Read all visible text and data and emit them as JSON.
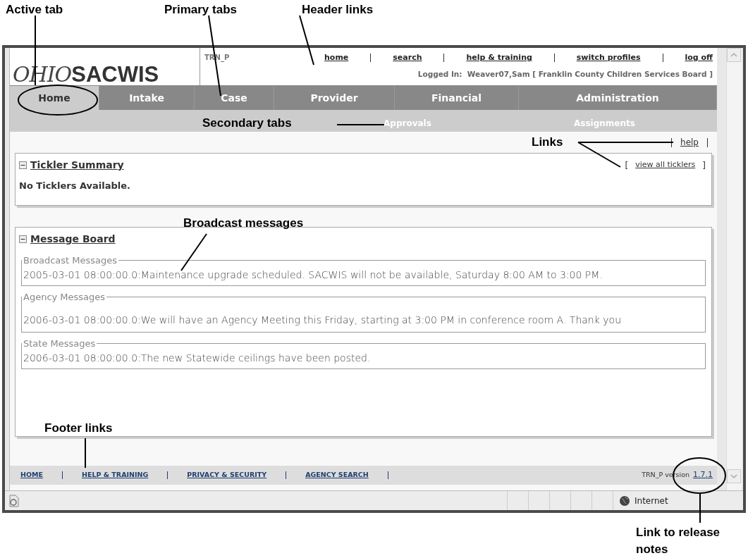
{
  "annotations": [
    {
      "text": "Active tab"
    },
    {
      "text": "Primary tabs"
    },
    {
      "text": "Header links"
    },
    {
      "text": "Secondary tabs"
    },
    {
      "text": "Links"
    },
    {
      "text": "Broadcast messages"
    },
    {
      "text": "Footer links"
    },
    {
      "text": "Link to release notes"
    }
  ],
  "window": {
    "logo": {
      "script": "OHIO",
      "wordmark": "SACWIS"
    },
    "environment": "TRN_P",
    "header_links": [
      {
        "label": "home"
      },
      {
        "label": "search"
      },
      {
        "label": "help & training"
      },
      {
        "label": "switch profiles"
      },
      {
        "label": "log off"
      }
    ],
    "logged_in": "Logged In:  Weaver07,Sam [ Franklin County Children Services Board ]",
    "primary_tabs": [
      {
        "label": "Home",
        "selected": true
      },
      {
        "label": "Intake",
        "selected": false
      },
      {
        "label": "Case",
        "selected": false
      },
      {
        "label": "Provider",
        "selected": false
      },
      {
        "label": "Financial",
        "selected": false
      },
      {
        "label": "Administration",
        "selected": false
      }
    ],
    "secondary_tabs": [
      {
        "label": "Approvals"
      },
      {
        "label": "Assignments"
      }
    ],
    "page_links": [
      {
        "label": "help"
      }
    ],
    "tickler_summary": {
      "title": "Tickler Summary",
      "expanded": true,
      "link": {
        "open": "[",
        "label": "view all ticklers",
        "close": "]"
      },
      "message": "No Ticklers Available."
    },
    "message_board": {
      "title": "Message Board",
      "expanded": true,
      "groups": [
        {
          "legend": "Broadcast Messages",
          "messages": [
            "2005-03-01 08:00:00.0:Maintenance upgrade scheduled. SACWIS will not be available, Saturday 8:00 AM to 3:00 PM."
          ]
        },
        {
          "legend": "Agency Messages",
          "messages": [
            "2006-03-01 08:00:00.0:We will have an Agency Meeting this Friday, starting at 3:00 PM in conference room A. Thank you"
          ]
        },
        {
          "legend": "State Messages",
          "messages": [
            "2006-03-01 08:00:00.0:The new Statewide ceilings have been posted."
          ]
        }
      ]
    },
    "footer": {
      "links": [
        {
          "label": "HOME"
        },
        {
          "label": "HELP & TRAINING"
        },
        {
          "label": "PRIVACY & SECURITY"
        },
        {
          "label": "AGENCY SEARCH"
        }
      ],
      "version_label": "TRN_P version",
      "version": "1.7.1"
    },
    "status_bar": {
      "zone": "Internet"
    }
  }
}
